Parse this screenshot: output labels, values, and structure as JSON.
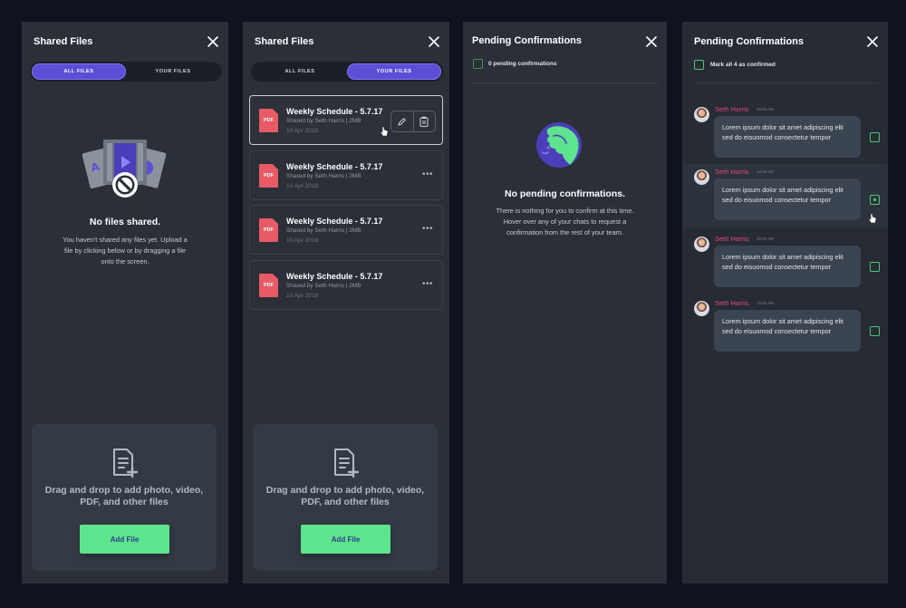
{
  "panel1": {
    "title": "Shared Files",
    "tabs": [
      "ALL FILES",
      "YOUR FILES"
    ],
    "active_tab": 0,
    "empty_title": "No files shared.",
    "empty_text": "You haven't shared any files yet. Upload a file by clicking below or by dragging a file onto the screen.",
    "dropzone_text": "Drag and drop to add photo, video, PDF, and other files",
    "add_button": "Add File"
  },
  "panel2": {
    "title": "Shared Files",
    "tabs": [
      "ALL FILES",
      "YOUR FILES"
    ],
    "active_tab": 1,
    "files": [
      {
        "icon_label": "PDF",
        "title": "Weekly Schedule - 5.7.17",
        "meta": "Shared by Seth Harris  |  2MB",
        "date": "10 Apr 2018"
      },
      {
        "icon_label": "PDF",
        "title": "Weekly Schedule - 5.7.17",
        "meta": "Shared by Seth Harris  |  2MB",
        "date": "10 Apr 2018"
      },
      {
        "icon_label": "PDF",
        "title": "Weekly Schedule - 5.7.17",
        "meta": "Shared by Seth Harris  |  2MB",
        "date": "10 Apr 2018"
      },
      {
        "icon_label": "PDF",
        "title": "Weekly Schedule - 5.7.17",
        "meta": "Shared by Seth Harris  |  2MB",
        "date": "10 Apr 2018"
      }
    ],
    "more_glyph": "•••",
    "dropzone_text": "Drag and drop to add photo, video, PDF, and other files",
    "add_button": "Add File"
  },
  "panel3": {
    "title": "Pending Confirmations",
    "check_label": "0 pending confirmations",
    "empty_title": "No pending confirmations.",
    "empty_text": "There is nothing for you to confirm at this time. Hover over any of your chats to request a confirmation from the rest of your team."
  },
  "panel4": {
    "title": "Pending Confirmations",
    "check_label": "Mark all 4 as confirmed",
    "messages": [
      {
        "name": "Seth Harris",
        "time": "10:04 AM",
        "text": "Lorem ipsum dolor sit amet adipiscing elit sed do eisuomod consectetur tempor"
      },
      {
        "name": "Seth Harris",
        "time": "10:04 AM",
        "text": "Lorem ipsum dolor sit amet adipiscing elit sed do eisuomod consectetur tempor"
      },
      {
        "name": "Seth Harris",
        "time": "10:04 AM",
        "text": "Lorem ipsum dolor sit amet adipiscing elit sed do eisuomod consectetur tempor"
      },
      {
        "name": "Seth Harris",
        "time": "10:04 AM",
        "text": "Lorem ipsum dolor sit amet adipiscing elit sed do eisuomod consectetur tempor"
      }
    ]
  },
  "colors": {
    "accent_purple": "#5b4fd6",
    "accent_green": "#5ee38f",
    "pdf_red": "#e85a66",
    "name_pink": "#e2477b"
  },
  "icons": [
    "close-icon",
    "pdf-icon",
    "edit-icon",
    "clipboard-icon",
    "more-icon",
    "file-add-icon",
    "checkbox-icon",
    "avatar"
  ]
}
